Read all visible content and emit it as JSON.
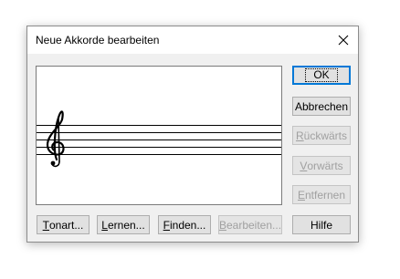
{
  "dialog": {
    "title": "Neue Akkorde bearbeiten",
    "close_icon": "close-icon"
  },
  "staff": {
    "clef_icon": "treble-clef-icon"
  },
  "side_buttons": {
    "ok": "OK",
    "cancel": "Abbrechen",
    "back": {
      "mnemonic": "R",
      "rest": "ückwärts"
    },
    "forward": {
      "mnemonic": "V",
      "rest": "orwärts"
    },
    "remove": {
      "mnemonic": "E",
      "rest": "ntfernen"
    }
  },
  "bottom_buttons": {
    "key": {
      "mnemonic": "T",
      "rest": "onart..."
    },
    "learn": {
      "mnemonic": "L",
      "rest": "ernen..."
    },
    "find": {
      "mnemonic": "F",
      "rest": "inden..."
    },
    "edit": {
      "mnemonic": "B",
      "rest": "earbeiten..."
    },
    "help": "Hilfe"
  },
  "colors": {
    "accent": "#0078d7",
    "disabled_text": "#a0a0a0"
  }
}
